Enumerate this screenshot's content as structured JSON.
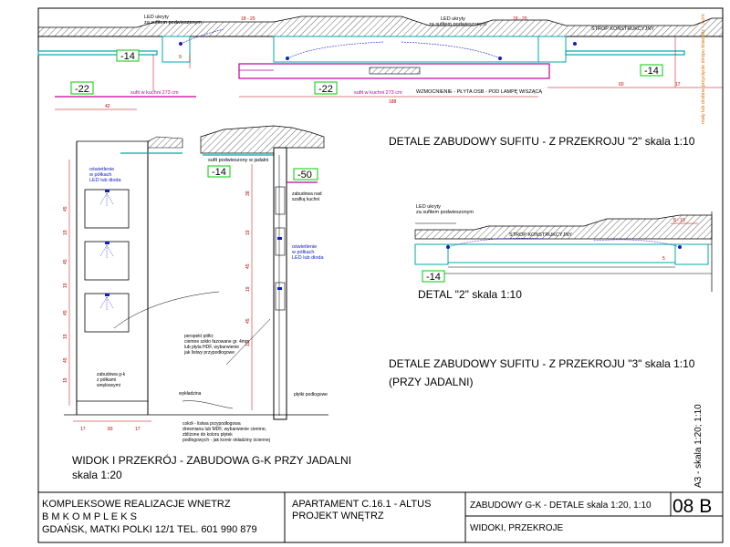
{
  "titles": {
    "detail2": "DETALE ZABUDOWY SUFITU - Z PRZEKROJU  \"2\" skala 1:10",
    "detal2": "DETAL \"2\" skala 1:10",
    "detail3": "DETALE ZABUDOWY SUFITU - Z PRZEKROJU  \"3\" skala 1:10",
    "detail3b": "(PRZY JADALNI)",
    "view_line1": "WIDOK I PRZEKRÓJ - ZABUDOWA G-K PRZY JADALNI",
    "view_line2": "skala 1:20",
    "side_scale": "A3 - skala 1:20;  1:10"
  },
  "labels": {
    "led1": "LED ukryty",
    "led2": "za sufitem podwieszonym",
    "strop": "STROP KONSTRUKCYJNY",
    "sufit_kuchnia": "sufit w kuchni 273 cm",
    "wzmocnienie": "WZMOCNIENIE - PŁYTA OSB - POD LAMPĘ WISZĄCĄ",
    "sufit_jadalnia": "sufit podwieszony w jadalni",
    "zab_nad1": "zabudowa nad",
    "zab_nad2": "szafką kuchni",
    "osw1": "oświetlenie",
    "osw2": "w półkach",
    "osw3": "LED lub dioda",
    "perspect": [
      "perspekt półki:",
      "ciemne szkło fazowane gr. 4mm",
      "lub płyta HDF, wybarwienie",
      "jak listwy przypodłogowe"
    ],
    "zabudowa": [
      "zabudowa g-k",
      "z półkami",
      "wnękowymi"
    ],
    "wykladzina": "wykładzina",
    "plytki": "płytki podłogowe",
    "cokol": [
      "cokół - listwa przypodłogowa",
      "drewniana lub MDF, wybarwienie ciemne,",
      "zbliżone do koloru płytek",
      "podłogowych - jak kornir okładziny ściennej"
    ],
    "side_note": "mały lub drobne przycięcie stropu krawędz - 3 cm"
  },
  "badges": {
    "b14a": "-14",
    "b22a": "-22",
    "b22b": "-22",
    "b14b": "-14",
    "b14c": "-14",
    "b50": "-50",
    "b14d": "-14"
  },
  "dims": {
    "d1820a": "18 - 20",
    "d1820b": "18 - 20",
    "d42": "42",
    "d188": "188",
    "d60": "60",
    "d9": "9",
    "d17": "17",
    "d810": "8 - 10",
    "d5": "5",
    "left_col": [
      "45",
      "19",
      "45",
      "19",
      "45",
      "19",
      "45",
      "19"
    ],
    "mid_col": [
      "38",
      "19",
      "45",
      "19",
      "45",
      "19"
    ],
    "bottom": [
      "17",
      "83",
      "17"
    ]
  },
  "titleblock": {
    "company1": "KOMPLEKSOWE REALIZACJE WNETRZ",
    "company2": "B M K O M P L E K S",
    "address": "GDAŃSK, MATKI POLKI 12/1  TEL. 601 990 879",
    "project1": "APARTAMENT C.16.1 - ALTUS",
    "project2": "PROJEKT WNĘTRZ",
    "sheet_title": "ZABUDOWY G-K - DETALE  skala 1:20, 1:10",
    "sheet_code": "08 B",
    "sheet_sub": "WIDOKI, PRZEKROJE"
  },
  "colors": {
    "frame": "#000000",
    "gypsum": "#00a8a8",
    "magenta": "#c000a0",
    "blue": "#1020c0",
    "dim_red": "#c00000",
    "badge_green": "#00cc00",
    "side_orange": "#e07000"
  }
}
